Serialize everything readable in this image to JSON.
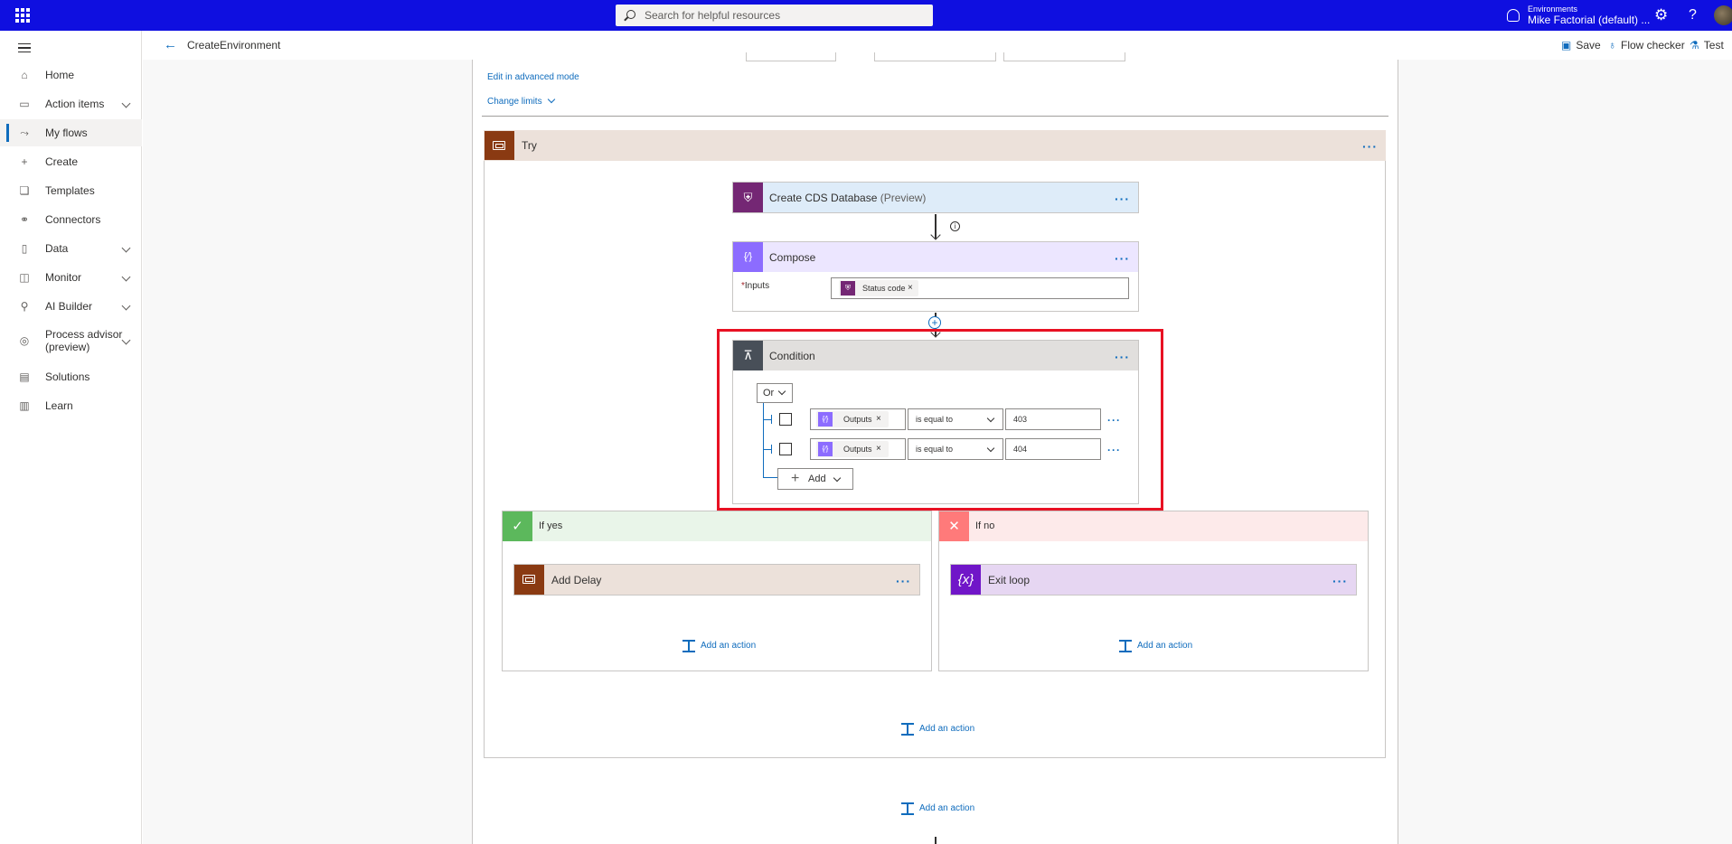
{
  "topbar": {
    "search_placeholder": "Search for helpful resources",
    "environment_label": "Environments",
    "environment_name": "Mike Factorial (default) ...",
    "settings_icon": "gear-icon",
    "help_glyph": "?"
  },
  "sidebar": {
    "items": [
      {
        "label": "Home",
        "icon": "home-icon"
      },
      {
        "label": "Action items",
        "icon": "clipboard-icon"
      },
      {
        "label": "My flows",
        "icon": "flow-icon"
      },
      {
        "label": "Create",
        "icon": "plus-icon"
      },
      {
        "label": "Templates",
        "icon": "templates-icon"
      },
      {
        "label": "Connectors",
        "icon": "connectors-icon"
      },
      {
        "label": "Data",
        "icon": "database-icon"
      },
      {
        "label": "Monitor",
        "icon": "monitor-icon"
      },
      {
        "label": "AI Builder",
        "icon": "ai-builder-icon"
      },
      {
        "label": "Process advisor",
        "label2": "(preview)",
        "icon": "process-advisor-icon"
      },
      {
        "label": "Solutions",
        "icon": "solutions-icon"
      },
      {
        "label": "Learn",
        "icon": "book-icon"
      }
    ]
  },
  "command_bar": {
    "flow_name": "CreateEnvironment",
    "save": "Save",
    "flow_checker": "Flow checker",
    "test": "Test"
  },
  "designer": {
    "edit_advanced": "Edit in advanced mode",
    "change_limits": "Change limits",
    "scope": {
      "title": "Try"
    },
    "create_db": {
      "title": "Create CDS Database",
      "suffix": "(Preview)"
    },
    "compose": {
      "title": "Compose",
      "inputs_label": "Inputs",
      "required_mark": "*",
      "token": "Status code"
    },
    "condition": {
      "title": "Condition",
      "group_operator": "Or",
      "rows": [
        {
          "token": "Outputs",
          "operator": "is equal to",
          "value": "403"
        },
        {
          "token": "Outputs",
          "operator": "is equal to",
          "value": "404"
        }
      ],
      "add_label": "Add"
    },
    "if_yes": {
      "title": "If yes",
      "action": "Add Delay",
      "add_action": "Add an action"
    },
    "if_no": {
      "title": "If no",
      "action": "Exit loop",
      "add_action": "Add an action"
    },
    "scope_add_action": "Add an action",
    "outer_add_action": "Add an action"
  },
  "colors": {
    "topbar": "#0f0fe0",
    "accent": "#0f6cbd",
    "highlight": "#e81123",
    "scope_icon": "#8a3a12",
    "cds_icon": "#742774",
    "compose_icon": "#8c6cff",
    "condition_icon": "#484f58",
    "yes_icon": "#5cb85c",
    "no_icon": "#ff7a7a",
    "variable_icon": "#7016c8"
  }
}
